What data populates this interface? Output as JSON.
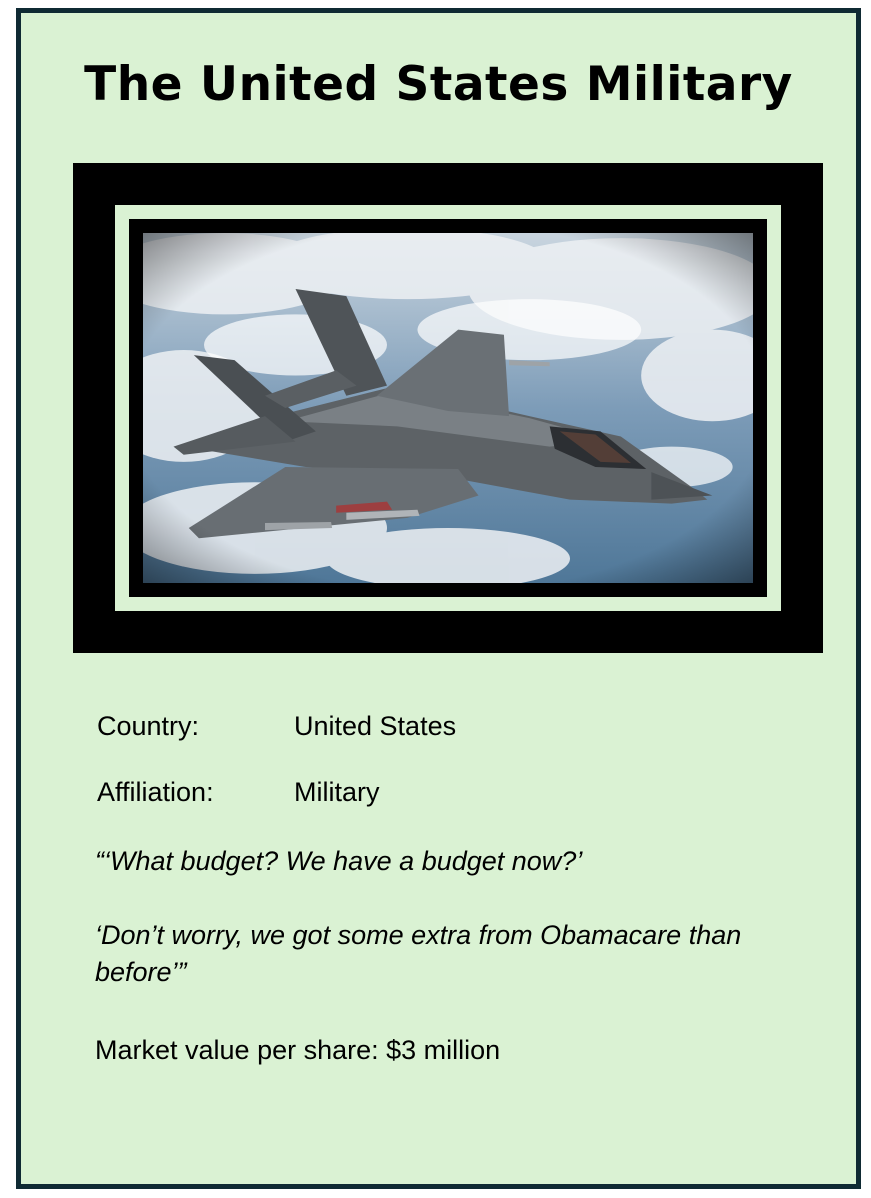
{
  "card": {
    "title": "The United States Military",
    "image_alt": "F-35 fighter jet flying above clouds",
    "fields": [
      {
        "label": "Country:",
        "value": "United States"
      },
      {
        "label": "Affiliation:",
        "value": "Military"
      }
    ],
    "quote_line1": "“‘What budget? We have a budget now?’",
    "quote_line2": "‘Don’t worry, we got some extra from Obamacare than before’”",
    "market_value": "Market value per share: $3 million"
  },
  "colors": {
    "card_background": "#daf2d3",
    "card_border": "#0f2a33",
    "frame": "#000000"
  }
}
